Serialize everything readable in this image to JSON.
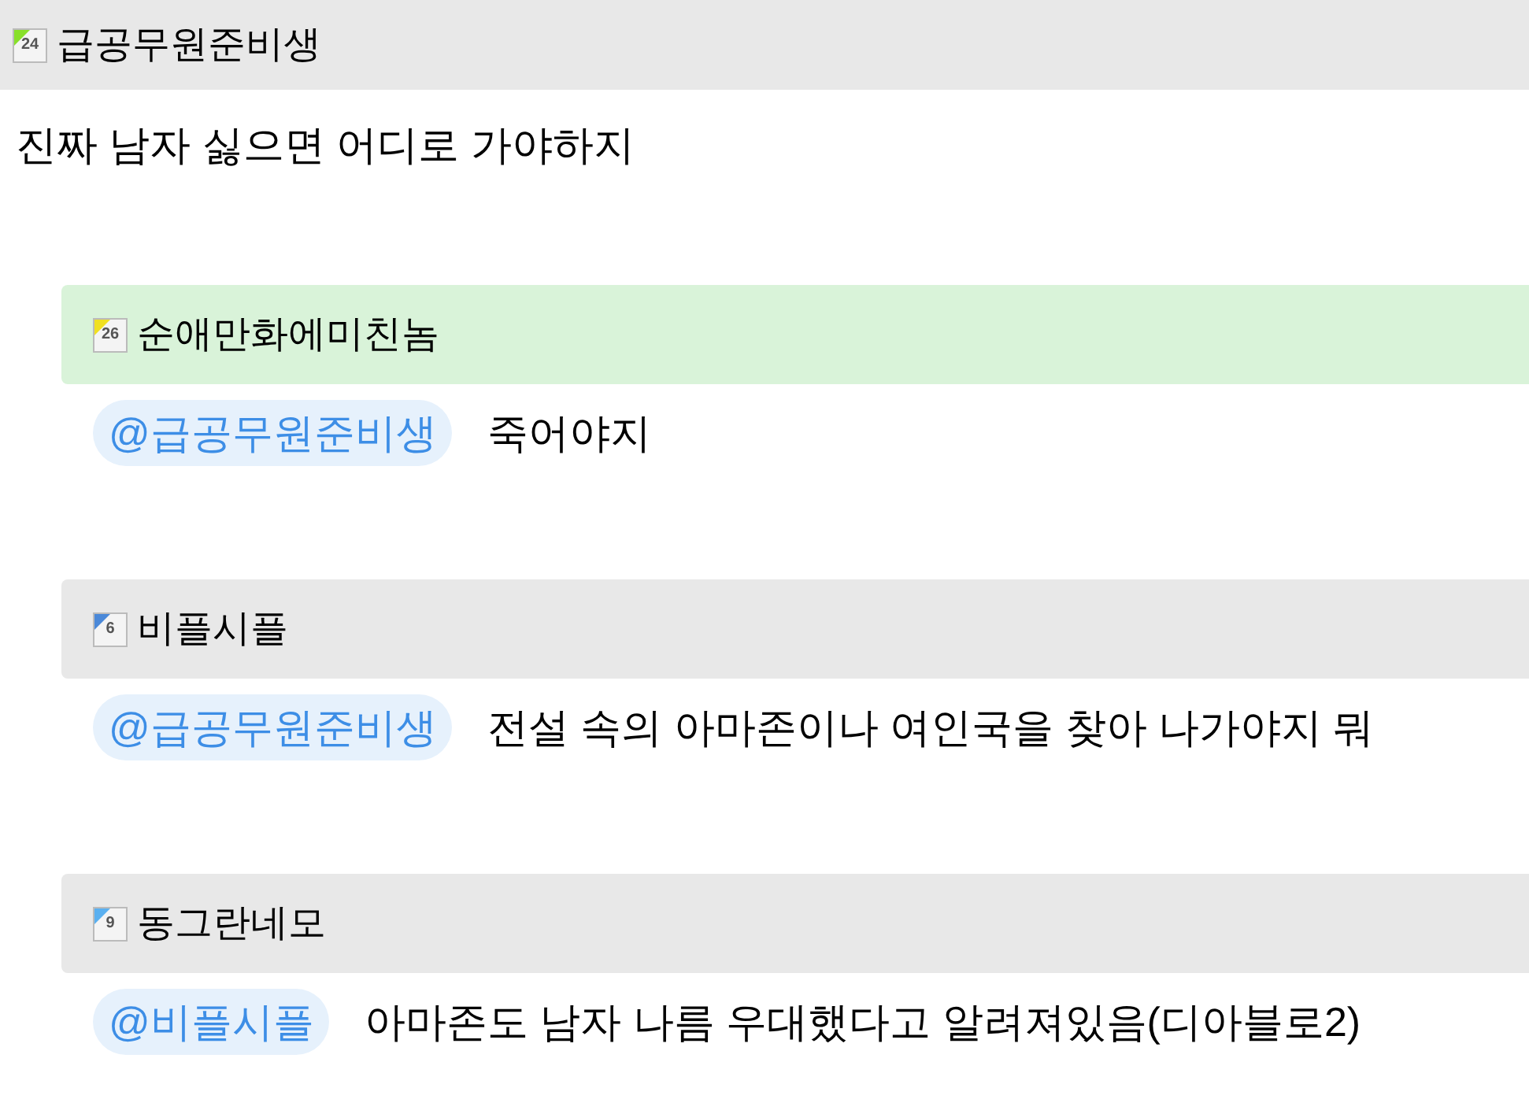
{
  "post": {
    "author": {
      "name": "급공무원준비생",
      "level": "24",
      "color": "#88e02a"
    },
    "text": "진짜 남자 싫으면 어디로 가야하지"
  },
  "replies": [
    {
      "author": {
        "name": "순애만화에미친놈",
        "level": "26",
        "color": "#f0e020"
      },
      "highlighted": true,
      "mention": "@급공무원준비생",
      "text": "죽어야지"
    },
    {
      "author": {
        "name": "비플시플",
        "level": "6",
        "color": "#4a88d8"
      },
      "highlighted": false,
      "mention": "@급공무원준비생",
      "text": "전설 속의 아마존이나 여인국을 찾아 나가야지 뭐"
    },
    {
      "author": {
        "name": "동그란네모",
        "level": "9",
        "color": "#5ab0f0"
      },
      "highlighted": false,
      "mention": "@비플시플",
      "text": "아마존도 남자 나름 우대했다고 알려져있음(디아블로2)"
    }
  ]
}
